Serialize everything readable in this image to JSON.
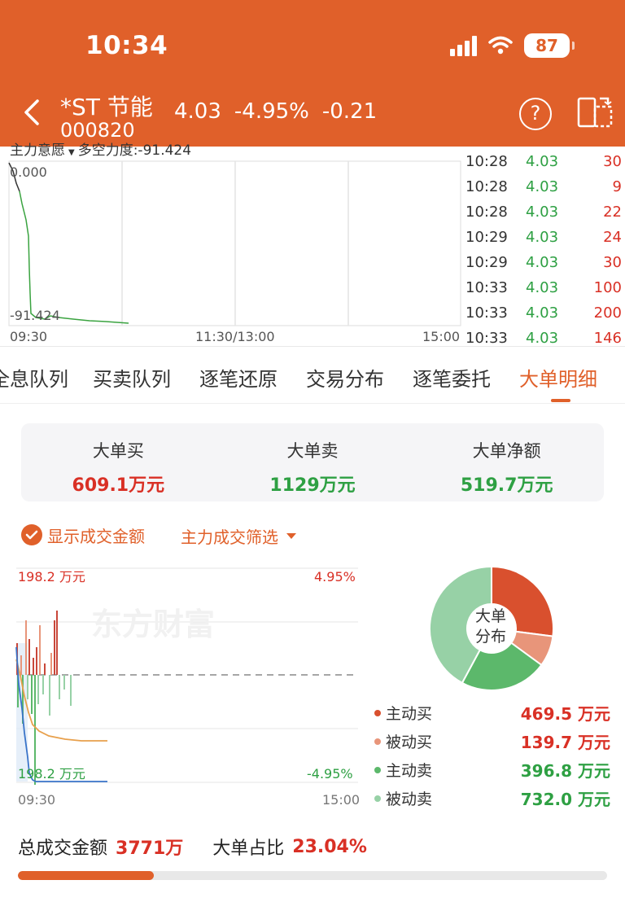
{
  "status_bar": {
    "time": "10:34",
    "battery": "87"
  },
  "header": {
    "stock_name": "*ST 节能",
    "stock_code": "000820",
    "price": "4.03",
    "change_pct": "-4.95%",
    "change": "-0.21",
    "help_icon": "?"
  },
  "intraday": {
    "clipped_label": "主力意愿",
    "clipped_value": "多空力度:-91.424",
    "y_top": "0.000",
    "y_bottom": "-91.424",
    "x_labels": [
      "09:30",
      "11:30/13:00",
      "15:00"
    ],
    "ticks": [
      {
        "time": "10:28",
        "price": "4.03",
        "volume": "30"
      },
      {
        "time": "10:28",
        "price": "4.03",
        "volume": "9"
      },
      {
        "time": "10:28",
        "price": "4.03",
        "volume": "22"
      },
      {
        "time": "10:29",
        "price": "4.03",
        "volume": "24"
      },
      {
        "time": "10:29",
        "price": "4.03",
        "volume": "30"
      },
      {
        "time": "10:33",
        "price": "4.03",
        "volume": "100"
      },
      {
        "time": "10:33",
        "price": "4.03",
        "volume": "200"
      },
      {
        "time": "10:33",
        "price": "4.03",
        "volume": "146"
      }
    ]
  },
  "tabs": [
    {
      "label": "全息队列"
    },
    {
      "label": "买卖队列"
    },
    {
      "label": "逐笔还原"
    },
    {
      "label": "交易分布"
    },
    {
      "label": "逐笔委托"
    },
    {
      "label": "大单明细",
      "active": true
    }
  ],
  "summary": {
    "buy_label": "大单买",
    "buy_value": "609.1万元",
    "sell_label": "大单卖",
    "sell_value": "1129万元",
    "net_label": "大单净额",
    "net_value": "519.7万元"
  },
  "options": {
    "show_amount_label": "显示成交金额",
    "show_amount_checked": true,
    "filter_label": "主力成交筛选"
  },
  "volume_chart": {
    "top_left": "198.2 万元",
    "top_right": "4.95%",
    "bottom_left": "198.2 万元",
    "bottom_right": "-4.95%",
    "x_start": "09:30",
    "x_end": "15:00",
    "watermark": "东方财富"
  },
  "pie": {
    "center_line1": "大单",
    "center_line2": "分布",
    "colors": [
      "#d9502e",
      "#e8957a",
      "#5cb86b",
      "#97d1a6"
    ]
  },
  "legend": [
    {
      "name": "主动买",
      "value": "469.5 万元",
      "amount": 469.5,
      "color": "#d9502e",
      "value_color": "#d93025"
    },
    {
      "name": "被动买",
      "value": "139.7 万元",
      "amount": 139.7,
      "color": "#e8957a",
      "value_color": "#d93025"
    },
    {
      "name": "主动卖",
      "value": "396.8 万元",
      "amount": 396.8,
      "color": "#5cb86b",
      "value_color": "#2ea043"
    },
    {
      "name": "被动卖",
      "value": "732.0 万元",
      "amount": 732.0,
      "color": "#97d1a6",
      "value_color": "#2ea043"
    }
  ],
  "footer": {
    "total_label": "总成交金额",
    "total_value": "3771万",
    "ratio_label": "大单占比",
    "ratio_value": "23.04%",
    "ratio": 0.2304
  }
}
